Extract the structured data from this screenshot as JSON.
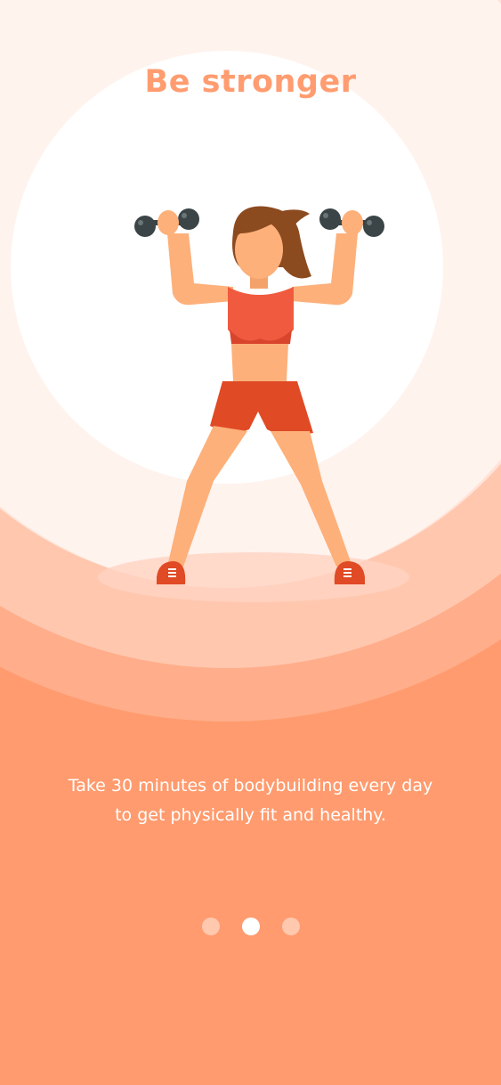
{
  "onboarding": {
    "title": "Be stronger",
    "description_line1": "Take 30 minutes of bodybuilding every day",
    "description_line2": "to get physically fit and healthy.",
    "illustration": "woman-lifting-dumbbells",
    "page_indicator": {
      "total": 3,
      "active_index": 1
    }
  },
  "colors": {
    "accent": "#ff9c70",
    "background_bottom": "#ff9b6e",
    "ring_1": "#ffad8a",
    "ring_2": "#ffc7ae",
    "ring_3": "#ffe3d7",
    "ring_4": "#fff3ee",
    "center_circle": "#ffffff"
  }
}
